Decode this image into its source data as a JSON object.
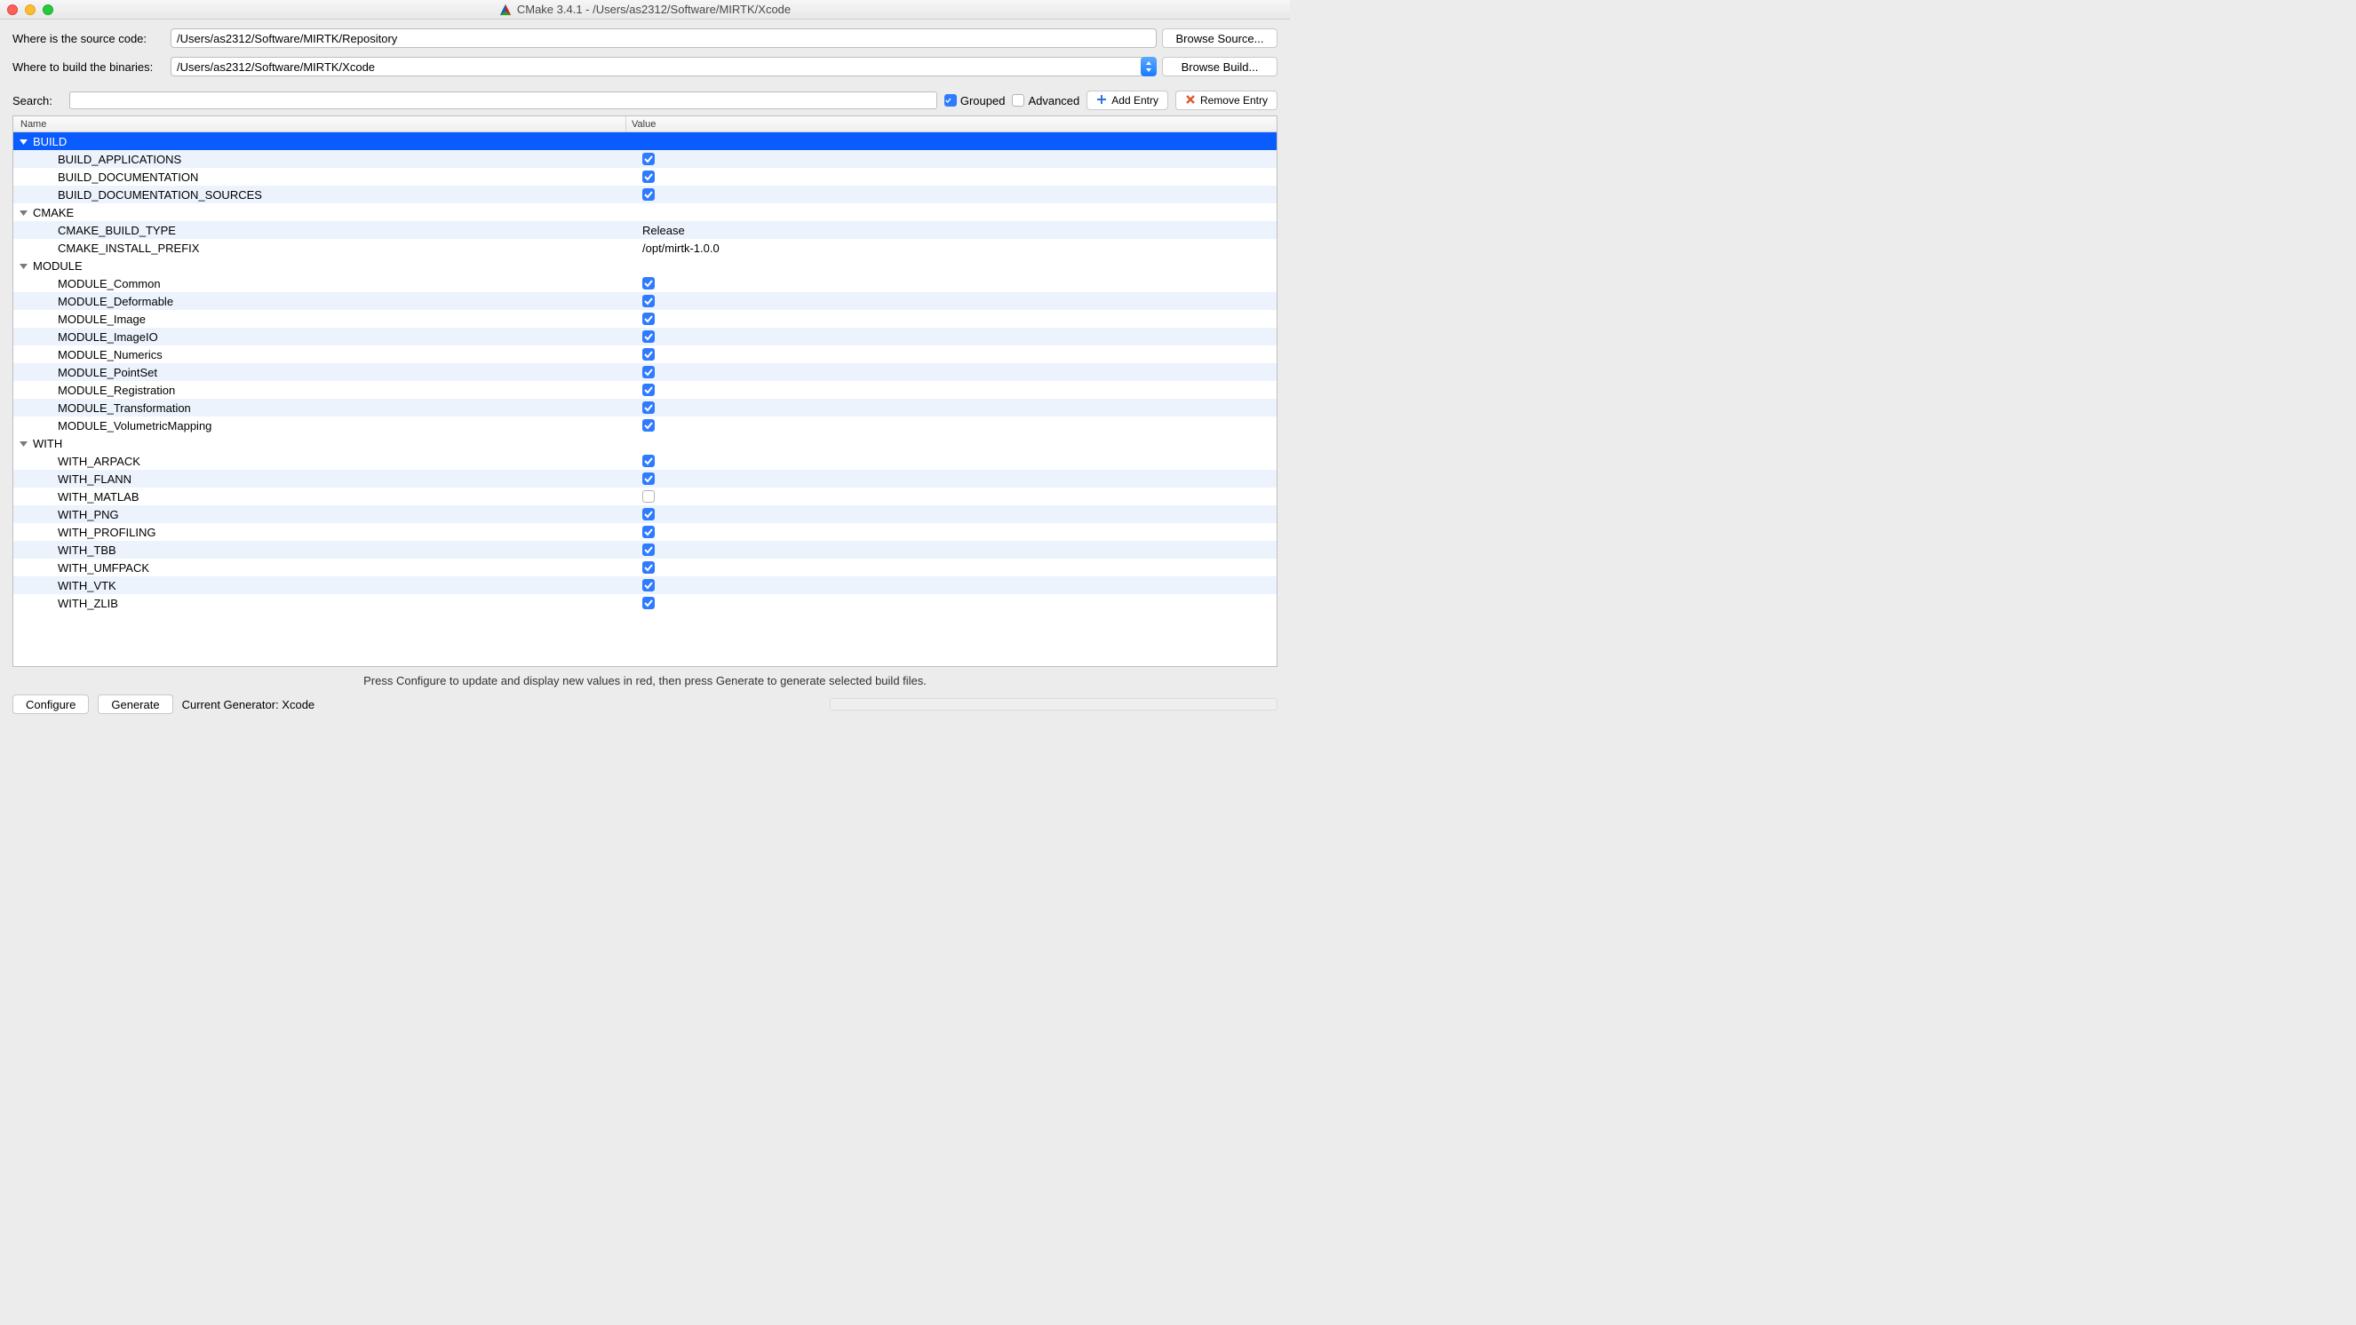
{
  "title": "CMake 3.4.1 - /Users/as2312/Software/MIRTK/Xcode",
  "labels": {
    "source": "Where is the source code:",
    "build": "Where to build the binaries:",
    "search": "Search:",
    "grouped": "Grouped",
    "advanced": "Advanced",
    "add_entry": "Add Entry",
    "remove_entry": "Remove Entry",
    "browse_source": "Browse Source...",
    "browse_build": "Browse Build...",
    "name_col": "Name",
    "value_col": "Value",
    "configure": "Configure",
    "generate": "Generate",
    "current_generator": "Current Generator: Xcode",
    "hint": "Press Configure to update and display new values in red, then press Generate to generate selected build files."
  },
  "paths": {
    "source": "/Users/as2312/Software/MIRTK/Repository",
    "build": "/Users/as2312/Software/MIRTK/Xcode"
  },
  "options": {
    "grouped": true,
    "advanced": false
  },
  "groups": [
    {
      "name": "BUILD",
      "selected": true,
      "children": [
        {
          "name": "BUILD_APPLICATIONS",
          "type": "bool",
          "value": true
        },
        {
          "name": "BUILD_DOCUMENTATION",
          "type": "bool",
          "value": true
        },
        {
          "name": "BUILD_DOCUMENTATION_SOURCES",
          "type": "bool",
          "value": true
        }
      ]
    },
    {
      "name": "CMAKE",
      "selected": false,
      "children": [
        {
          "name": "CMAKE_BUILD_TYPE",
          "type": "text",
          "value": "Release"
        },
        {
          "name": "CMAKE_INSTALL_PREFIX",
          "type": "text",
          "value": "/opt/mirtk-1.0.0"
        }
      ]
    },
    {
      "name": "MODULE",
      "selected": false,
      "children": [
        {
          "name": "MODULE_Common",
          "type": "bool",
          "value": true
        },
        {
          "name": "MODULE_Deformable",
          "type": "bool",
          "value": true
        },
        {
          "name": "MODULE_Image",
          "type": "bool",
          "value": true
        },
        {
          "name": "MODULE_ImageIO",
          "type": "bool",
          "value": true
        },
        {
          "name": "MODULE_Numerics",
          "type": "bool",
          "value": true
        },
        {
          "name": "MODULE_PointSet",
          "type": "bool",
          "value": true
        },
        {
          "name": "MODULE_Registration",
          "type": "bool",
          "value": true
        },
        {
          "name": "MODULE_Transformation",
          "type": "bool",
          "value": true
        },
        {
          "name": "MODULE_VolumetricMapping",
          "type": "bool",
          "value": true
        }
      ]
    },
    {
      "name": "WITH",
      "selected": false,
      "children": [
        {
          "name": "WITH_ARPACK",
          "type": "bool",
          "value": true
        },
        {
          "name": "WITH_FLANN",
          "type": "bool",
          "value": true
        },
        {
          "name": "WITH_MATLAB",
          "type": "bool",
          "value": false
        },
        {
          "name": "WITH_PNG",
          "type": "bool",
          "value": true
        },
        {
          "name": "WITH_PROFILING",
          "type": "bool",
          "value": true
        },
        {
          "name": "WITH_TBB",
          "type": "bool",
          "value": true
        },
        {
          "name": "WITH_UMFPACK",
          "type": "bool",
          "value": true
        },
        {
          "name": "WITH_VTK",
          "type": "bool",
          "value": true
        },
        {
          "name": "WITH_ZLIB",
          "type": "bool",
          "value": true
        }
      ]
    }
  ]
}
